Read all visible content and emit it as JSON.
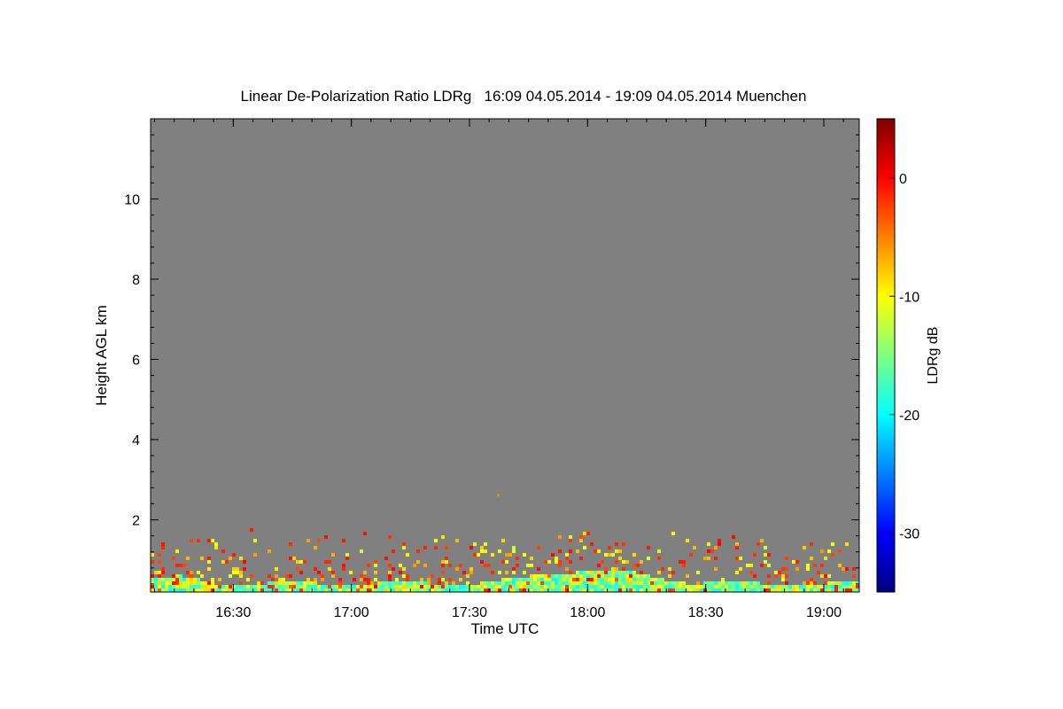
{
  "chart_data": {
    "type": "heatmap",
    "title": "Linear De-Polarization Ratio LDRg   16:09 04.05.2014 - 19:09 04.05.2014 Muenchen",
    "xlabel": "Time UTC",
    "ylabel": "Height AGL km",
    "colorbar_label": "LDRg dB",
    "x_range": [
      "16:09",
      "19:09"
    ],
    "x_ticks": [
      "16:30",
      "17:00",
      "17:30",
      "18:00",
      "18:30",
      "19:00"
    ],
    "ylim": [
      0.2,
      12
    ],
    "y_ticks": [
      2,
      4,
      6,
      8,
      10
    ],
    "color_range": [
      -35,
      5
    ],
    "colorbar_ticks": [
      0,
      -10,
      -20,
      -30
    ],
    "colormap": "jet",
    "no_data_color": "#808080",
    "features": {
      "aerosol_layer_top_km": 1.8,
      "dense_layer_top_km": 1.0,
      "isolated_echo": {
        "time": "17:37",
        "height_km": 2.6,
        "ldr_db": -5
      }
    }
  }
}
